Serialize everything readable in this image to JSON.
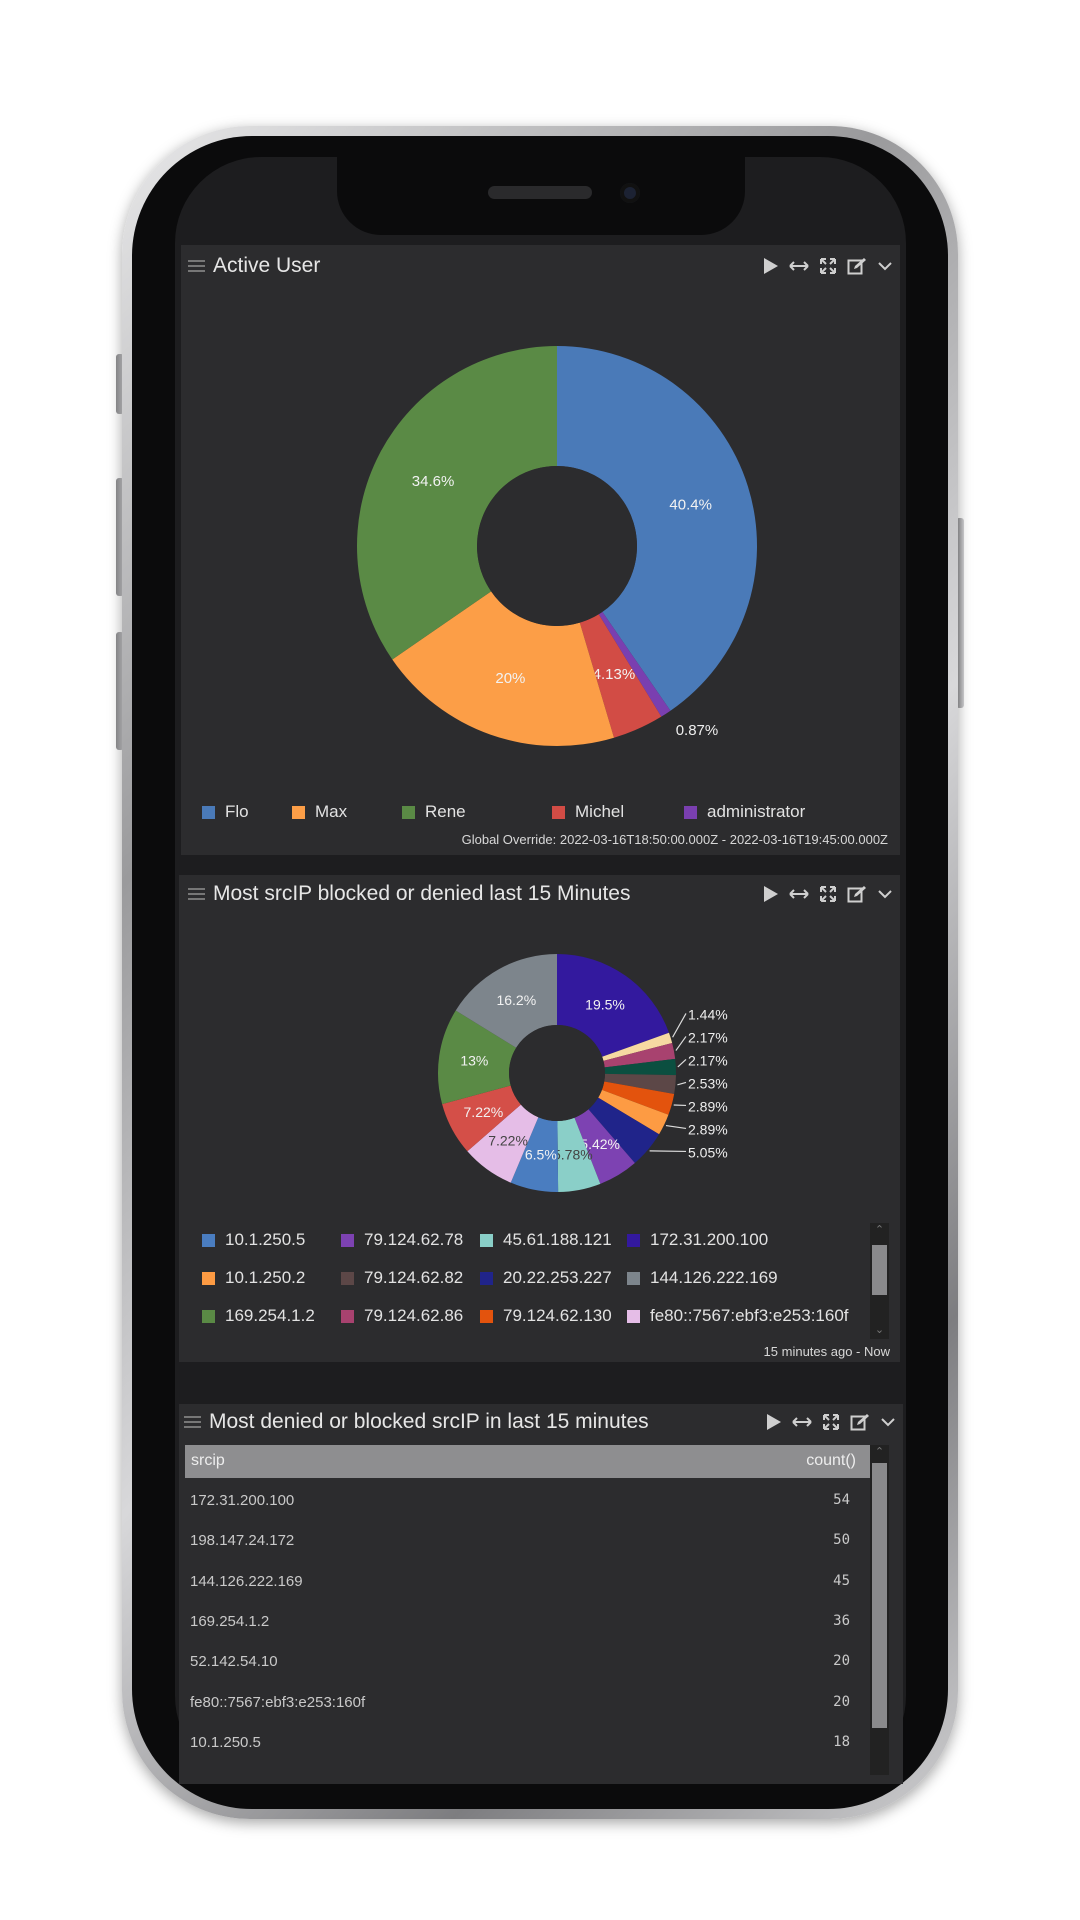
{
  "panels": [
    {
      "title": "Active User",
      "footer": "Global Override: 2022-03-16T18:50:00.000Z - 2022-03-16T19:45:00.000Z"
    },
    {
      "title": "Most srcIP blocked or denied last 15 Minutes",
      "footer": "15 minutes ago - Now"
    },
    {
      "title": "Most denied or blocked srcIP in last 15 minutes",
      "columns": [
        "srcip",
        "count()"
      ],
      "rows": [
        [
          "172.31.200.100",
          "54"
        ],
        [
          "198.147.24.172",
          "50"
        ],
        [
          "144.126.222.169",
          "45"
        ],
        [
          "169.254.1.2",
          "36"
        ],
        [
          "52.142.54.10",
          "20"
        ],
        [
          "fe80::7567:ebf3:e253:160f",
          "20"
        ],
        [
          "10.1.250.5",
          "18"
        ]
      ]
    }
  ],
  "panel_icons": [
    "menu-icon",
    "play-icon",
    "resize-horizontal-icon",
    "expand-icon",
    "edit-icon",
    "chevron-down-icon"
  ],
  "chart_data": [
    {
      "type": "pie",
      "donut": true,
      "legend_position": "bottom",
      "slices": [
        {
          "name": "Flo",
          "value": 40.4,
          "label": "40.4%",
          "color": "#4a7ab8"
        },
        {
          "name": "administrator",
          "value": 0.87,
          "label": "0.87%",
          "color": "#7a3fb0"
        },
        {
          "name": "Michel",
          "value": 4.13,
          "label": "4.13%",
          "color": "#d24c45"
        },
        {
          "name": "Max",
          "value": 20,
          "label": "20%",
          "color": "#fc9e47"
        },
        {
          "name": "Rene",
          "value": 34.6,
          "label": "34.6%",
          "color": "#5a8a45"
        }
      ],
      "legend": [
        "Flo",
        "Max",
        "Rene",
        "Michel",
        "administrator"
      ]
    },
    {
      "type": "pie",
      "donut": true,
      "legend_position": "bottom",
      "slices": [
        {
          "name": "172.31.200.100",
          "value": 19.5,
          "label": "19.5%",
          "color": "#33199e"
        },
        {
          "name": "",
          "value": 1.44,
          "label": "1.44%",
          "color": "#f6d9a2"
        },
        {
          "name": "79.124.62.86",
          "value": 2.17,
          "label": "2.17%",
          "color": "#a8426f"
        },
        {
          "name": "",
          "value": 2.17,
          "label": "2.17%",
          "color": "#0b4f40"
        },
        {
          "name": "79.124.62.82",
          "value": 2.53,
          "label": "2.53%",
          "color": "#5c4747"
        },
        {
          "name": "79.124.62.130",
          "value": 2.89,
          "label": "2.89%",
          "color": "#e3530d"
        },
        {
          "name": "10.1.250.2",
          "value": 2.89,
          "label": "2.89%",
          "color": "#fd9b43"
        },
        {
          "name": "20.22.253.227",
          "value": 5.05,
          "label": "5.05%",
          "color": "#20248a"
        },
        {
          "name": "79.124.62.78",
          "value": 5.42,
          "label": "5.42%",
          "color": "#7d42b2"
        },
        {
          "name": "45.61.188.121",
          "value": 5.78,
          "label": "5.78%",
          "color": "#8acfc8"
        },
        {
          "name": "10.1.250.5",
          "value": 6.5,
          "label": "6.5%",
          "color": "#4a7dc0"
        },
        {
          "name": "fe80::7567:ebf3:e253:160f",
          "value": 7.22,
          "label": "7.22%",
          "color": "#e5bde7"
        },
        {
          "name": "",
          "value": 7.22,
          "label": "7.22%",
          "color": "#d44f48"
        },
        {
          "name": "169.254.1.2",
          "value": 13,
          "label": "13%",
          "color": "#5a8a45"
        },
        {
          "name": "144.126.222.169",
          "value": 16.2,
          "label": "16.2%",
          "color": "#7d858c"
        }
      ],
      "legend": [
        [
          "10.1.250.5",
          "79.124.62.78",
          "45.61.188.121",
          "172.31.200.100"
        ],
        [
          "10.1.250.2",
          "79.124.62.82",
          "20.22.253.227",
          "144.126.222.169"
        ],
        [
          "169.254.1.2",
          "79.124.62.86",
          "79.124.62.130",
          "fe80::7567:ebf3:e253:160f"
        ]
      ]
    }
  ]
}
